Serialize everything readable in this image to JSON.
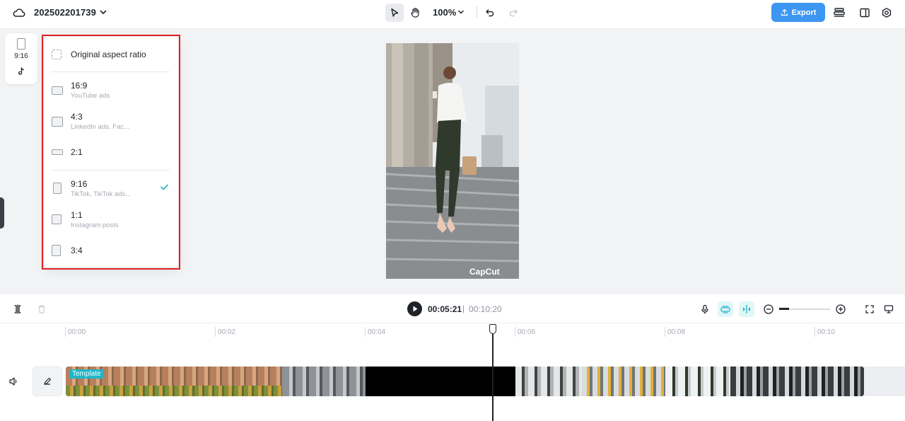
{
  "header": {
    "project_name": "202502201739",
    "zoom_label": "100%",
    "export_label": "Export"
  },
  "ratio_card": {
    "current_ratio": "9:16"
  },
  "aspect_menu": {
    "original_label": "Original aspect ratio",
    "options": [
      {
        "name": "16:9",
        "desc": "YouTube ads"
      },
      {
        "name": "4:3",
        "desc": "LinkedIn ads, Fac..."
      },
      {
        "name": "2:1",
        "desc": ""
      },
      {
        "name": "9:16",
        "desc": "TikTok, TikTok ads...",
        "selected": true
      },
      {
        "name": "1:1",
        "desc": "Instagram posts"
      },
      {
        "name": "3:4",
        "desc": ""
      }
    ]
  },
  "preview": {
    "watermark": "CapCut"
  },
  "timeline": {
    "current_time": "00:05:21",
    "divider": "|",
    "total_time": "00:10:20",
    "ruler": [
      "00:00",
      "00:02",
      "00:04",
      "00:06",
      "00:08",
      "00:10"
    ],
    "template_badge": "Template"
  },
  "colors": {
    "accent": "#3d96f2",
    "highlight": "#e02020",
    "teal": "#20b6c8"
  }
}
